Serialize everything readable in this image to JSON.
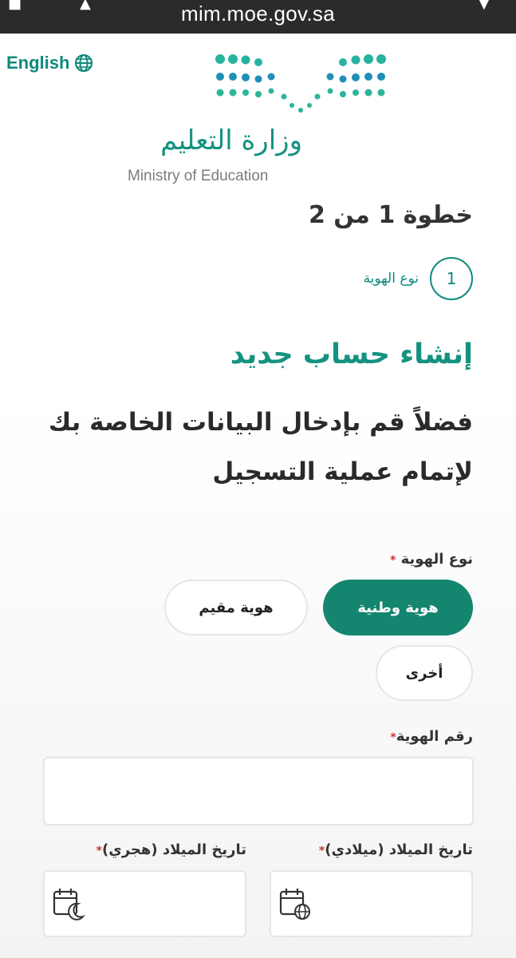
{
  "browser": {
    "url": "mim.moe.gov.sa"
  },
  "header": {
    "language_label": "English",
    "ministry_name_ar": "وزارة التعليم",
    "ministry_name_en": "Ministry of Education"
  },
  "steps": {
    "title": "خطوة 1 من 2",
    "current_number": "1",
    "current_label": "نوع الهوية"
  },
  "intro": {
    "heading": "إنشاء حساب جديد",
    "subheading": "فضلاً قم بإدخال البيانات الخاصة بك لإتمام عملية التسجيل"
  },
  "form": {
    "id_type": {
      "label": "نوع الهوية",
      "required_mark": "*",
      "options": [
        {
          "label": "هوية وطنية",
          "selected": true
        },
        {
          "label": "هوية مقيم",
          "selected": false
        },
        {
          "label": "أخرى",
          "selected": false
        }
      ]
    },
    "id_number": {
      "label": "رقم الهوية",
      "required_mark": "*",
      "value": ""
    },
    "birth_gregorian": {
      "label": "تاريخ الميلاد (ميلادي)",
      "required_mark": "*",
      "value": ""
    },
    "birth_hijri": {
      "label": "تاريخ الميلاد (هجري)",
      "required_mark": "*",
      "value": ""
    }
  },
  "colors": {
    "accent": "#14866f",
    "brand_text": "#14927f",
    "required": "#d32f2f"
  },
  "icons": {
    "language": "globe-icon",
    "gregorian_date": "calendar-globe-icon",
    "hijri_date": "calendar-moon-icon"
  }
}
